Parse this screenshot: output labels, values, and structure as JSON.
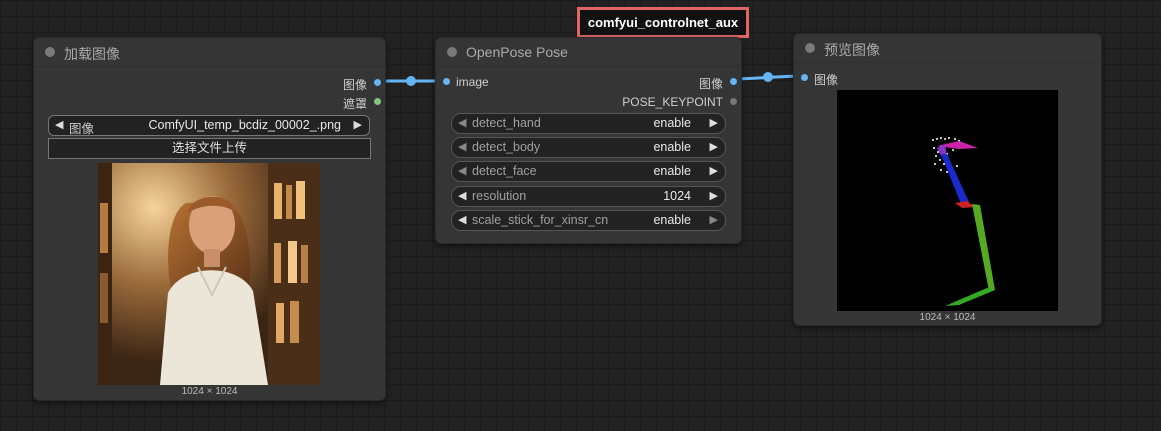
{
  "annotation": {
    "tag": "comfyui_controlnet_aux"
  },
  "load_image_node": {
    "title": "加载图像",
    "outputs": {
      "image": "图像",
      "mask": "遮罩"
    },
    "image_widget": {
      "name": "图像",
      "value": "ComfyUI_temp_bcdiz_00002_.png"
    },
    "upload_button": "选择文件上传",
    "image_size": "1024 × 1024"
  },
  "openpose_node": {
    "title": "OpenPose Pose",
    "input": {
      "image": "image"
    },
    "outputs": {
      "image": "图像",
      "keypoint": "POSE_KEYPOINT"
    },
    "widgets": [
      {
        "name": "detect_hand",
        "value": "enable"
      },
      {
        "name": "detect_body",
        "value": "enable"
      },
      {
        "name": "detect_face",
        "value": "enable"
      },
      {
        "name": "resolution",
        "value": "1024"
      },
      {
        "name": "scale_stick_for_xinsr_cn",
        "value": "enable"
      }
    ]
  },
  "preview_node": {
    "title": "预览图像",
    "input": {
      "image": "图像"
    },
    "image_size": "1024 × 1024"
  },
  "colors": {
    "canvas": "#222222",
    "node": "#353535",
    "image_link": "#64b5f6",
    "mask_slot": "#81c784",
    "annotation_border": "#e06565"
  }
}
